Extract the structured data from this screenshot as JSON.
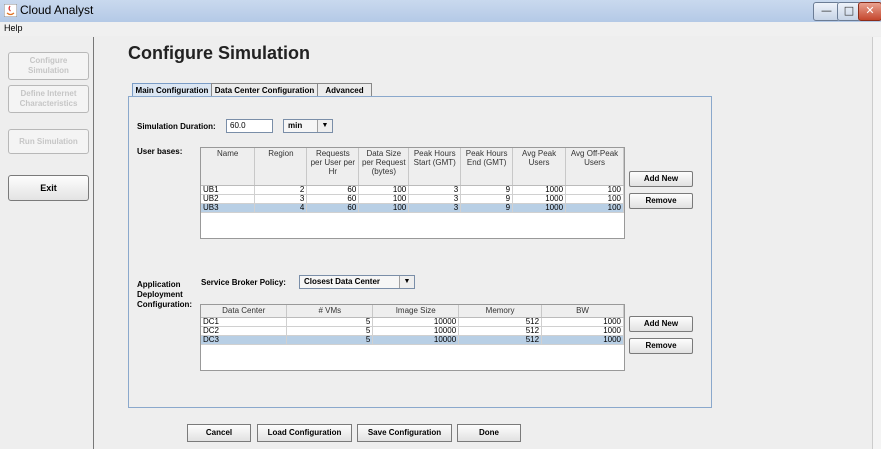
{
  "window": {
    "title": "Cloud Analyst",
    "minimize": "—",
    "maximize": "□",
    "close": "✕"
  },
  "menu": {
    "help": "Help"
  },
  "sidebar": {
    "configure": "Configure Simulation",
    "internet": "Define Internet Characteristics",
    "run": "Run Simulation",
    "exit": "Exit"
  },
  "page_title": "Configure Simulation",
  "tabs": [
    "Main Configuration",
    "Data Center Configuration",
    "Advanced"
  ],
  "simulation": {
    "duration_label": "Simulation Duration:",
    "duration_value": "60.0",
    "unit": "min"
  },
  "user_bases": {
    "label": "User bases:",
    "columns": [
      "Name",
      "Region",
      "Requests per User per Hr",
      "Data Size per Request (bytes)",
      "Peak Hours Start (GMT)",
      "Peak Hours End (GMT)",
      "Avg Peak Users",
      "Avg Off-Peak Users"
    ],
    "rows": [
      [
        "UB1",
        "2",
        "60",
        "100",
        "3",
        "9",
        "1000",
        "100"
      ],
      [
        "UB2",
        "3",
        "60",
        "100",
        "3",
        "9",
        "1000",
        "100"
      ],
      [
        "UB3",
        "4",
        "60",
        "100",
        "3",
        "9",
        "1000",
        "100"
      ]
    ],
    "add_new": "Add New",
    "remove": "Remove"
  },
  "deployment": {
    "label_lines": [
      "Application",
      "Deployment",
      "Configuration:"
    ],
    "broker_label": "Service Broker Policy:",
    "broker_value": "Closest Data Center",
    "columns": [
      "Data Center",
      "# VMs",
      "Image Size",
      "Memory",
      "BW"
    ],
    "rows": [
      [
        "DC1",
        "5",
        "10000",
        "512",
        "1000"
      ],
      [
        "DC2",
        "5",
        "10000",
        "512",
        "1000"
      ],
      [
        "DC3",
        "5",
        "10000",
        "512",
        "1000"
      ]
    ],
    "add_new": "Add New",
    "remove": "Remove"
  },
  "bottom": {
    "cancel": "Cancel",
    "load": "Load Configuration",
    "save": "Save Configuration",
    "done": "Done"
  }
}
